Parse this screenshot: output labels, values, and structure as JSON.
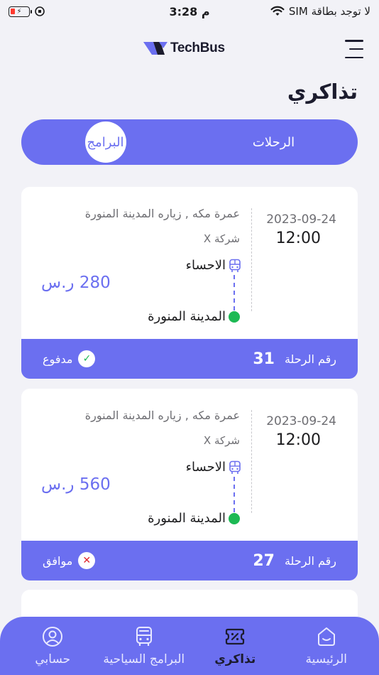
{
  "status_bar": {
    "carrier": "لا توجد بطاقة SIM",
    "time": "3:28 م"
  },
  "header": {
    "app_name": "TechBus",
    "menu_icon": "hamburger-menu-icon"
  },
  "page": {
    "title": "تذاكري"
  },
  "segment": {
    "tabs": [
      {
        "label": "الرحلات",
        "active": false
      },
      {
        "label": "البرامج",
        "active": true
      }
    ]
  },
  "tickets": [
    {
      "date": "2023-09-24",
      "time": "12:00",
      "program": "عمرة مكه , زياره المدينة المنورة",
      "company": "شركة X",
      "from": "الاحساء",
      "to": "المدينة المنورة",
      "price": "280 ر.س",
      "trip_number_label": "رقم الرحلة",
      "trip_number": "31",
      "status": "مدفوع",
      "status_icon": "check-icon"
    },
    {
      "date": "2023-09-24",
      "time": "12:00",
      "program": "عمرة مكه , زياره المدينة المنورة",
      "company": "شركة X",
      "from": "الاحساء",
      "to": "المدينة المنورة",
      "price": "560 ر.س",
      "trip_number_label": "رقم الرحلة",
      "trip_number": "27",
      "status": "موافق",
      "status_icon": "cross-icon"
    }
  ],
  "nav": {
    "items": [
      {
        "label": "الرئيسية",
        "icon": "home-icon",
        "active": false
      },
      {
        "label": "تذاكري",
        "icon": "ticket-icon",
        "active": true
      },
      {
        "label": "البرامج السياحية",
        "icon": "bus-icon",
        "active": false
      },
      {
        "label": "حسابي",
        "icon": "account-icon",
        "active": false
      }
    ]
  },
  "colors": {
    "primary": "#6b6ff0",
    "success": "#1db954",
    "danger": "#e0242b",
    "background": "#f2f2f7"
  }
}
